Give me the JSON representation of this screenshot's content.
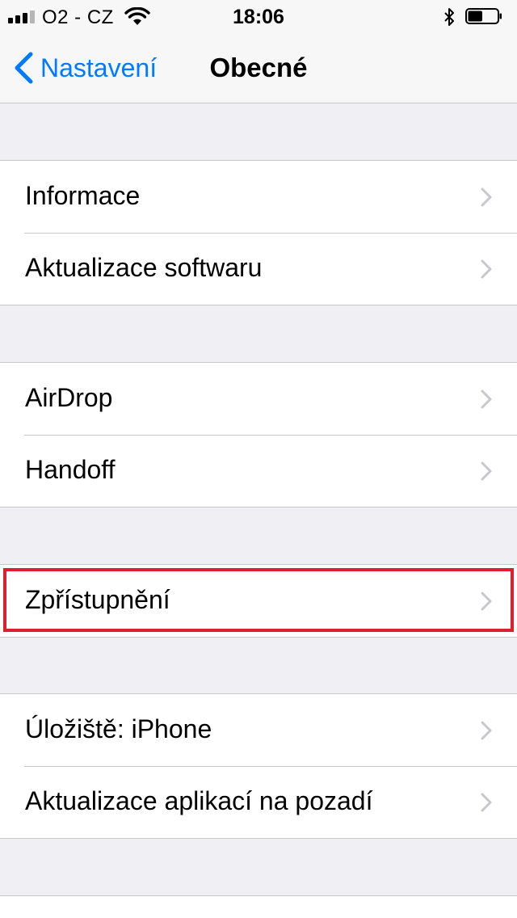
{
  "status_bar": {
    "carrier": "O2 - CZ",
    "time": "18:06",
    "signal_bars": 4,
    "signal_bars_filled": 3,
    "battery_level": 0.5,
    "icons": [
      "signal-icon",
      "wifi-icon",
      "bluetooth-icon",
      "battery-icon"
    ]
  },
  "nav": {
    "back_label": "Nastavení",
    "title": "Obecné",
    "back_icon": "chevron-left-icon"
  },
  "groups": [
    {
      "items": [
        {
          "label": "Informace"
        },
        {
          "label": "Aktualizace softwaru"
        }
      ]
    },
    {
      "items": [
        {
          "label": "AirDrop"
        },
        {
          "label": "Handoff"
        }
      ]
    },
    {
      "items": [
        {
          "label": "Zpřístupnění"
        }
      ]
    },
    {
      "items": [
        {
          "label": "Úložiště: iPhone"
        },
        {
          "label": "Aktualizace aplikací na pozadí"
        }
      ]
    }
  ],
  "colors": {
    "accent": "#007aff",
    "highlight": "#d9222e",
    "background": "#efeff4",
    "separator": "#c8c7cc",
    "chevron": "#c7c7cc"
  },
  "highlighted_item": "Zpřístupnění"
}
